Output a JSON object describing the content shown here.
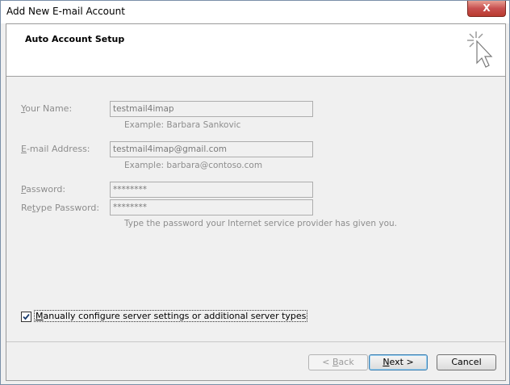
{
  "window": {
    "title": "Add New E-mail Account",
    "close_label": "X"
  },
  "header": {
    "title": "Auto Account Setup"
  },
  "form": {
    "name": {
      "label_prefix": "",
      "label_mnemonic": "Y",
      "label_rest": "our Name:",
      "value": "testmail4imap",
      "hint": "Example: Barbara Sankovic"
    },
    "email": {
      "label_prefix": "",
      "label_mnemonic": "E",
      "label_rest": "-mail Address:",
      "value": "testmail4imap@gmail.com",
      "hint": "Example: barbara@contoso.com"
    },
    "password": {
      "label_prefix": "",
      "label_mnemonic": "P",
      "label_rest": "assword:",
      "value": "********"
    },
    "retype": {
      "label_prefix": "Re",
      "label_mnemonic": "t",
      "label_rest": "ype Password:",
      "value": "********",
      "hint": "Type the password your Internet service provider has given you."
    }
  },
  "manual_config": {
    "checked": true,
    "label_mnemonic": "M",
    "label_rest": "anually configure server settings or additional server types"
  },
  "buttons": {
    "back": {
      "prefix": "< ",
      "mnemonic": "B",
      "rest": "ack"
    },
    "next": {
      "mnemonic": "N",
      "rest": "ext >"
    },
    "cancel": {
      "label": "Cancel"
    }
  }
}
